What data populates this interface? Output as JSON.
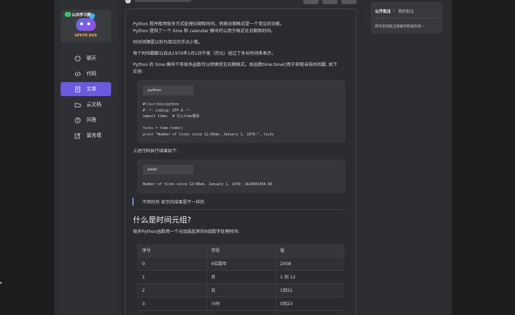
{
  "sidebar": {
    "logo_title": "公共学习圈",
    "logo_sub": "APHTE BUS",
    "items": [
      {
        "label": "聊天",
        "icon": "chat-icon"
      },
      {
        "label": "代码",
        "icon": "code-icon"
      },
      {
        "label": "文章",
        "icon": "article-icon",
        "active": true
      },
      {
        "label": "云文档",
        "icon": "folder-icon"
      },
      {
        "label": "问答",
        "icon": "question-icon"
      },
      {
        "label": "留言墙",
        "icon": "edit-icon"
      }
    ]
  },
  "article": {
    "paragraphs": [
      "Python 程序能用很多方式处理日期和时间，转换日期格式是一个常见的功能。",
      "Python 提供了一个 time 和 calendar 模块可以用于格式化日期和时间。",
      "时间间隔是以秒为单位的浮点小数。",
      "每个时间戳都以自从1970年1月1日午夜（历元）经过了多长时间来表示。",
      "Python 的 time 模块下有很多函数可以转换常见日期格式。如函数time.time()用于获取当前时间戳, 如下",
      "实例:"
    ],
    "code1": {
      "lang": "python",
      "lines": [
        "#!/usr/bin/python",
        "# -*- coding: UTF-8 -*-",
        "import time;  # 引入time模块",
        "",
        "ticks = time.time()",
        "print \"Number of ticks since 12:00am, January 1, 1970:\", ticks"
      ]
    },
    "result_intro": "上述代码执行结果如下：",
    "code2": {
      "lang": "bash",
      "lines": [
        "Number of ticks since 12:00am, January 1, 1970: 1626082364.68"
      ]
    },
    "quote": "不同时间 显示的结果是不一样的",
    "heading": "什么是时间元组?",
    "heading_intro": "很多Python函数用一个元组装起来的9组数字处理时间:",
    "table": {
      "headers": [
        "序号",
        "字段",
        "值"
      ],
      "rows": [
        [
          "0",
          "4位数年",
          "2008"
        ],
        [
          "1",
          "月",
          "1 到 12"
        ],
        [
          "2",
          "日",
          "1到31"
        ],
        [
          "3",
          "小时",
          "0到23"
        ]
      ]
    }
  },
  "right_panel": {
    "tab_public": "公开批注",
    "separator": "|",
    "tab_mine": "我的批注",
    "hint": "即可添加批注或者你想说的话~"
  }
}
